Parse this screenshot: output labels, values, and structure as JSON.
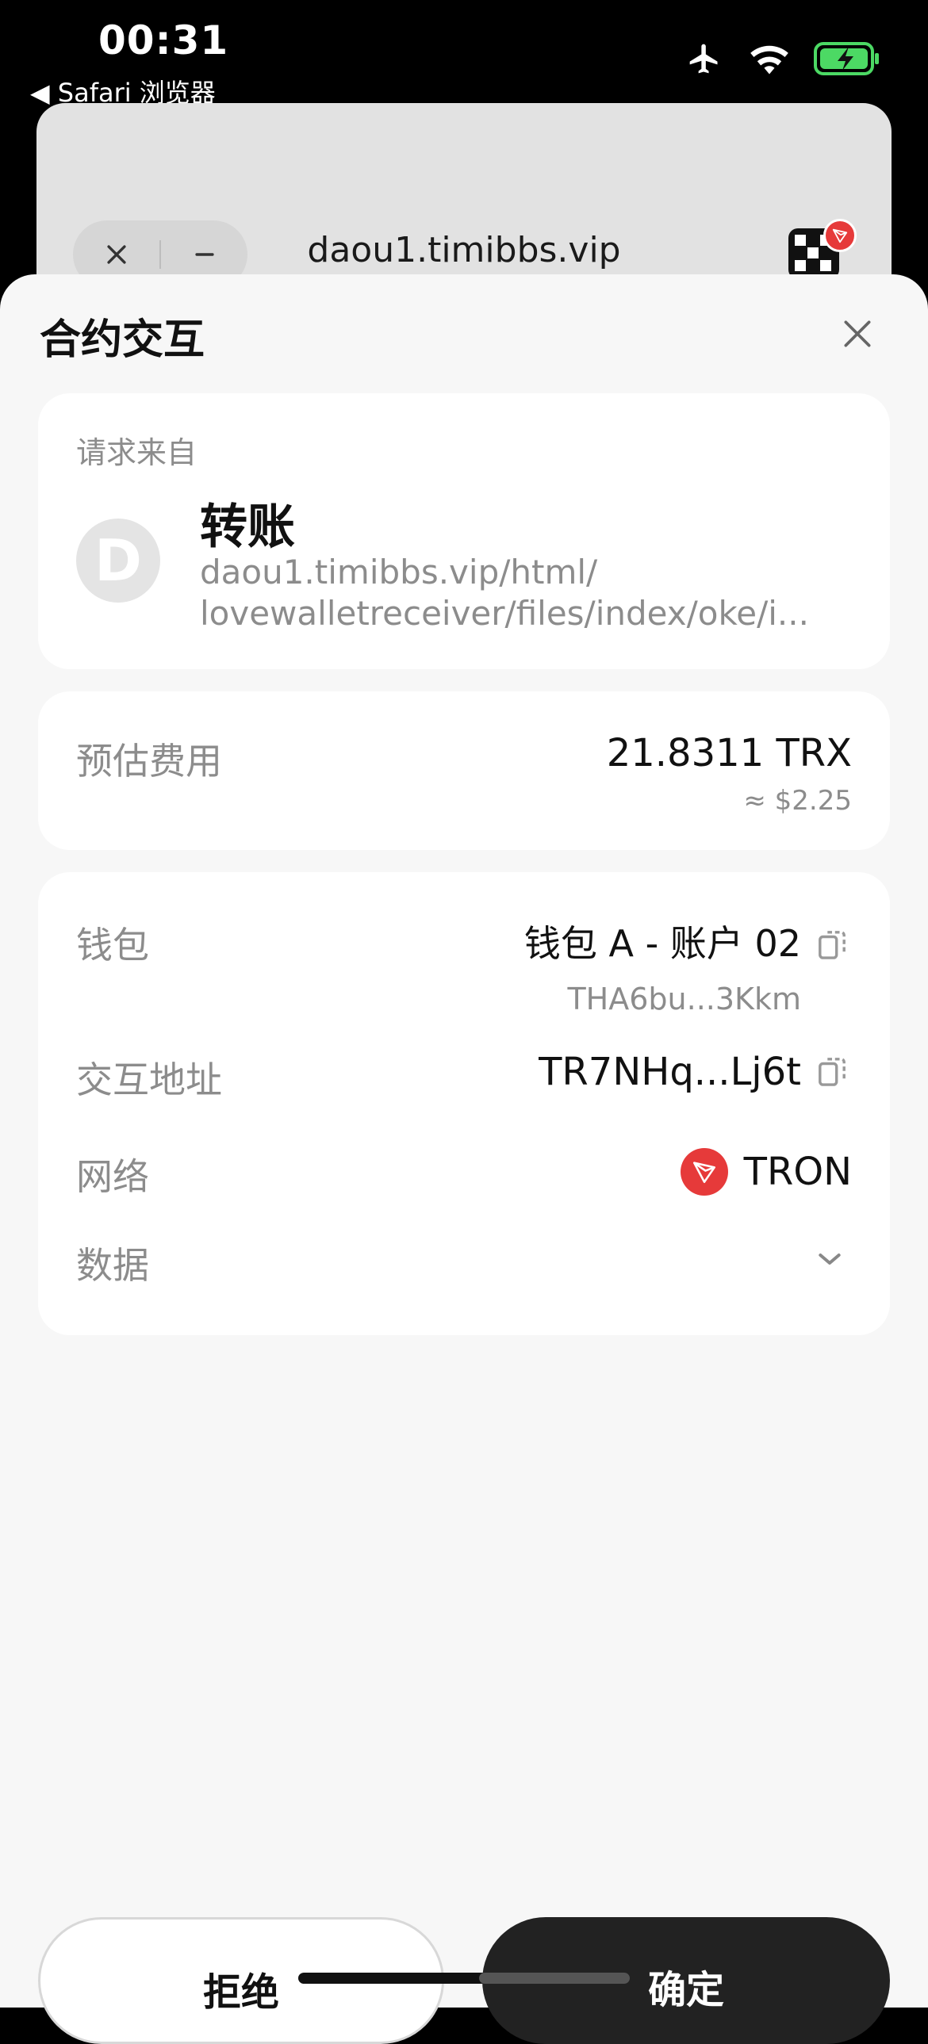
{
  "status": {
    "time": "00:31",
    "back_label": "◀ Safari 浏览器",
    "battery_color": "#4cd964"
  },
  "browser": {
    "domain": "daou1.timibbs.vip"
  },
  "sheet": {
    "title": "合约交互",
    "request": {
      "label": "请求来自",
      "avatar_letter": "D",
      "title": "转账",
      "url_line1": "daou1.timibbs.vip/html/",
      "url_line2": "lovewalletreceiver/files/index/oke/i..."
    },
    "fee": {
      "label": "预估费用",
      "value": "21.8311 TRX",
      "usd": "≈ $2.25"
    },
    "details": {
      "wallet_label": "钱包",
      "wallet_name": "钱包 A - 账户 02",
      "wallet_address": "THA6bu...3Kkm",
      "interact_label": "交互地址",
      "interact_address": "TR7NHq...Lj6t",
      "network_label": "网络",
      "network_name": "TRON",
      "data_label": "数据"
    },
    "buttons": {
      "reject": "拒绝",
      "confirm": "确定"
    }
  },
  "colors": {
    "accent_red": "#e63a3a",
    "confirm_bg": "#222222",
    "muted_text": "#8c8c8c"
  }
}
